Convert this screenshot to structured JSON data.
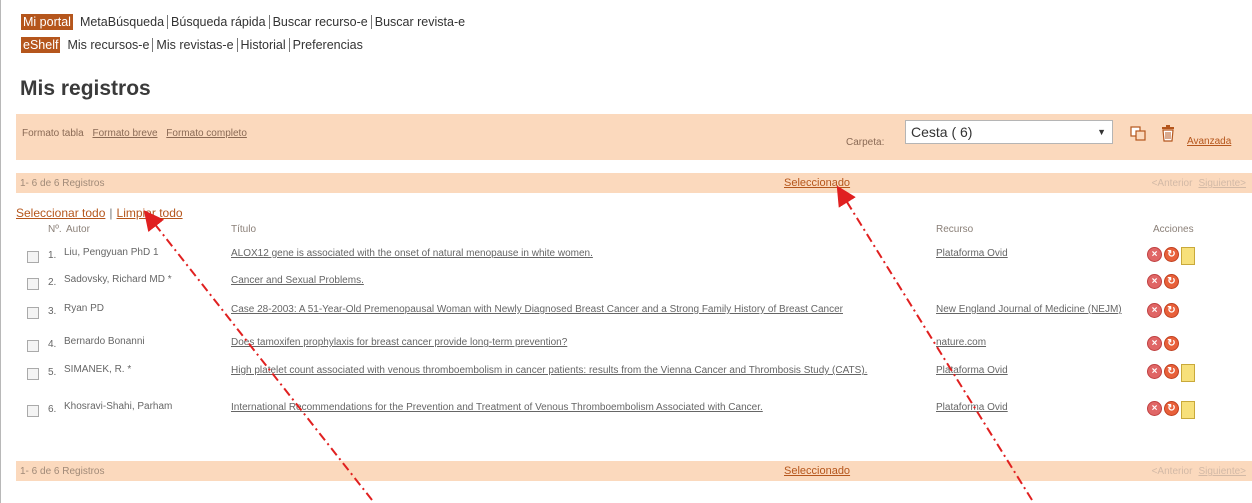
{
  "nav": {
    "row1": [
      "Mi portal",
      "MetaBúsqueda",
      "Búsqueda rápida",
      "Buscar recurso-e",
      "Buscar revista-e"
    ],
    "row2": [
      "eShelf",
      "Mis recursos-e",
      "Mis revistas-e",
      "Historial",
      "Preferencias"
    ]
  },
  "page_title": "Mis registros",
  "toolbar": {
    "format_table": "Formato tabla",
    "format_brief": "Formato breve",
    "format_full": "Formato completo",
    "folder_label": "Carpeta:",
    "folder_value": "Cesta ( 6)",
    "advanced": "Avanzada"
  },
  "range": {
    "count_text": "1- 6 de 6 Registros",
    "selected": "Seleccionado",
    "prev": "<Anterior",
    "next": "Siguiente>"
  },
  "select_all": "Seleccionar todo",
  "clear_all": "Limpiar todo",
  "headers": {
    "num": "Nº.",
    "author": "Autor",
    "title": "Título",
    "resource": "Recurso",
    "actions": "Acciones"
  },
  "records": [
    {
      "num": "1.",
      "author": "Liu, Pengyuan PhD 1",
      "title": "ALOX12 gene is associated with the onset of natural menopause in white women.",
      "resource": "Plataforma Ovid",
      "fulltext": true
    },
    {
      "num": "2.",
      "author": "Sadovsky, Richard MD *",
      "title": "Cancer and Sexual Problems.",
      "resource": "",
      "fulltext": false
    },
    {
      "num": "3.",
      "author": "Ryan PD",
      "title": "Case 28-2003: A 51-Year-Old Premenopausal Woman with Newly Diagnosed Breast Cancer and a Strong Family History of Breast Cancer",
      "resource": "New England Journal of Medicine (NEJM)",
      "fulltext": false
    },
    {
      "num": "4.",
      "author": "Bernardo Bonanni",
      "title": "Does tamoxifen prophylaxis for breast cancer provide long-term prevention?",
      "resource": "nature.com",
      "fulltext": false
    },
    {
      "num": "5.",
      "author": "SIMANEK, R. *",
      "title": "High platelet count associated with venous thromboembolism in cancer patients: results from the Vienna Cancer and Thrombosis Study (CATS).",
      "resource": "Plataforma Ovid",
      "fulltext": true
    },
    {
      "num": "6.",
      "author": "Khosravi-Shahi, Parham",
      "title": "International Recommendations for the Prevention and Treatment of Venous Thromboembolism Associated with Cancer.",
      "resource": "Plataforma Ovid",
      "fulltext": true
    }
  ],
  "icons": {
    "copy": "copy-icon",
    "trash": "trash-icon",
    "delete": "delete-icon",
    "refresh": "refresh-icon",
    "fulltext": "document-icon"
  },
  "colors": {
    "accent": "#b5561c",
    "toolbar_bg": "#fbd9bd",
    "arrow": "#e02020"
  }
}
